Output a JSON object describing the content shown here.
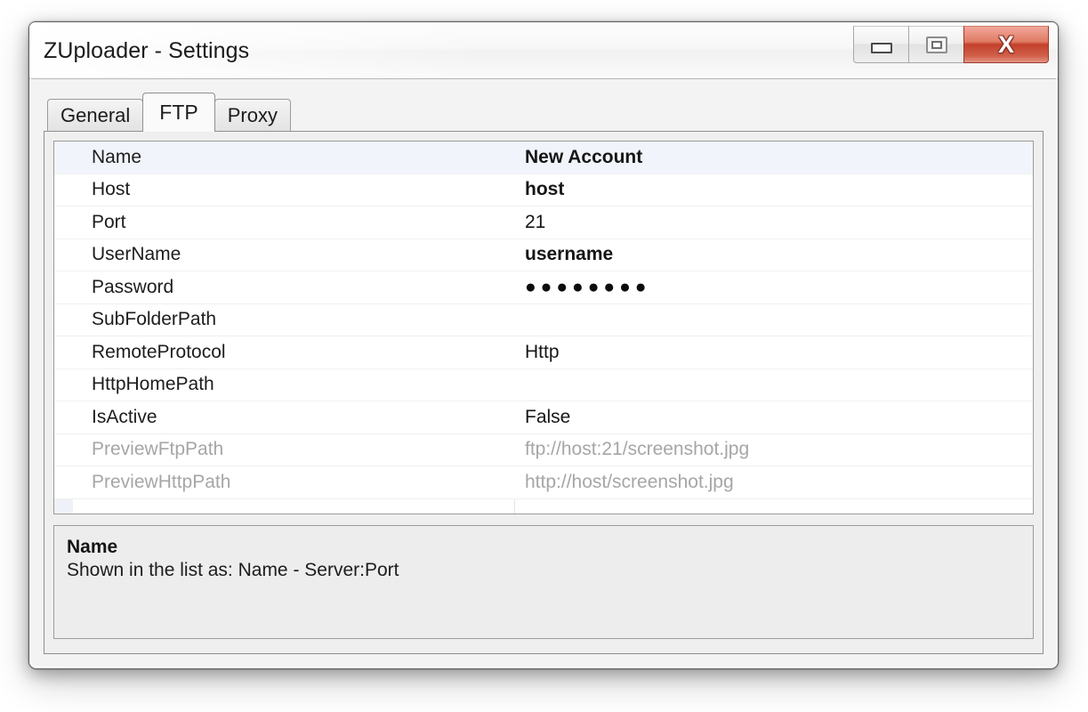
{
  "window": {
    "title": "ZUploader - Settings",
    "controls": {
      "minimize": "minimize",
      "maximize": "maximize",
      "close": "X"
    }
  },
  "tabs": [
    {
      "label": "General",
      "active": false
    },
    {
      "label": "FTP",
      "active": true
    },
    {
      "label": "Proxy",
      "active": false
    }
  ],
  "property_grid": {
    "rows": [
      {
        "name": "Name",
        "value": "New Account",
        "bold": true,
        "readonly": false,
        "selected": true
      },
      {
        "name": "Host",
        "value": "host",
        "bold": true,
        "readonly": false,
        "selected": false
      },
      {
        "name": "Port",
        "value": "21",
        "bold": false,
        "readonly": false,
        "selected": false
      },
      {
        "name": "UserName",
        "value": "username",
        "bold": true,
        "readonly": false,
        "selected": false
      },
      {
        "name": "Password",
        "value": "●●●●●●●●",
        "bold": false,
        "readonly": false,
        "selected": false,
        "masked": true
      },
      {
        "name": "SubFolderPath",
        "value": "",
        "bold": false,
        "readonly": false,
        "selected": false
      },
      {
        "name": "RemoteProtocol",
        "value": "Http",
        "bold": false,
        "readonly": false,
        "selected": false
      },
      {
        "name": "HttpHomePath",
        "value": "",
        "bold": false,
        "readonly": false,
        "selected": false
      },
      {
        "name": "IsActive",
        "value": "False",
        "bold": false,
        "readonly": false,
        "selected": false
      },
      {
        "name": "PreviewFtpPath",
        "value": "ftp://host:21/screenshot.jpg",
        "bold": false,
        "readonly": true,
        "selected": false
      },
      {
        "name": "PreviewHttpPath",
        "value": "http://host/screenshot.jpg",
        "bold": false,
        "readonly": true,
        "selected": false
      }
    ]
  },
  "description": {
    "title": "Name",
    "text": "Shown in the list as: Name - Server:Port"
  },
  "colors": {
    "selection_row": "#f1f4fb",
    "gutter": "#eef1f7",
    "close_button": "#c3412c",
    "readonly_text": "#a6a6a6",
    "panel_background": "#ededed"
  }
}
